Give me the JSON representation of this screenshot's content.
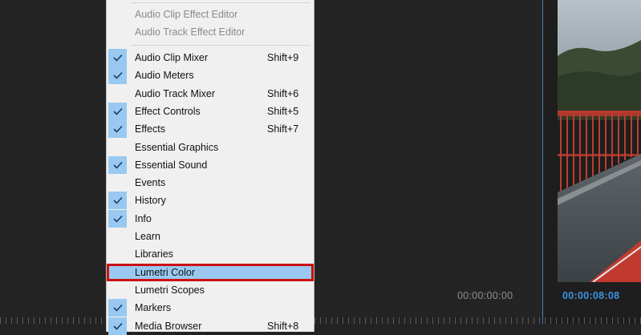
{
  "menu": {
    "items_top": [
      {
        "label": "Audio Clip Effect Editor",
        "enabled": false
      },
      {
        "label": "Audio Track Effect Editor",
        "enabled": false
      }
    ],
    "items": [
      {
        "label": "Audio Clip Mixer",
        "shortcut": "Shift+9",
        "checked": true
      },
      {
        "label": "Audio Meters",
        "shortcut": "",
        "checked": true
      },
      {
        "label": "Audio Track Mixer",
        "shortcut": "Shift+6",
        "checked": false
      },
      {
        "label": "Effect Controls",
        "shortcut": "Shift+5",
        "checked": true
      },
      {
        "label": "Effects",
        "shortcut": "Shift+7",
        "checked": true
      },
      {
        "label": "Essential Graphics",
        "shortcut": "",
        "checked": false
      },
      {
        "label": "Essential Sound",
        "shortcut": "",
        "checked": true
      },
      {
        "label": "Events",
        "shortcut": "",
        "checked": false
      },
      {
        "label": "History",
        "shortcut": "",
        "checked": true
      },
      {
        "label": "Info",
        "shortcut": "",
        "checked": true
      },
      {
        "label": "Learn",
        "shortcut": "",
        "checked": false
      },
      {
        "label": "Libraries",
        "shortcut": "",
        "checked": false
      },
      {
        "label": "Lumetri Color",
        "shortcut": "",
        "checked": false,
        "highlighted": true
      },
      {
        "label": "Lumetri Scopes",
        "shortcut": "",
        "checked": false
      },
      {
        "label": "Markers",
        "shortcut": "",
        "checked": true
      },
      {
        "label": "Media Browser",
        "shortcut": "Shift+8",
        "checked": true
      }
    ]
  },
  "timecodes": {
    "sequence": "00:00:00:00",
    "program": "00:00:08:08"
  },
  "colors": {
    "menu_bg": "#f0f0f0",
    "check_bg": "#99c9f0",
    "highlight_outline": "#cc1010",
    "program_timecode": "#3d93e0"
  }
}
